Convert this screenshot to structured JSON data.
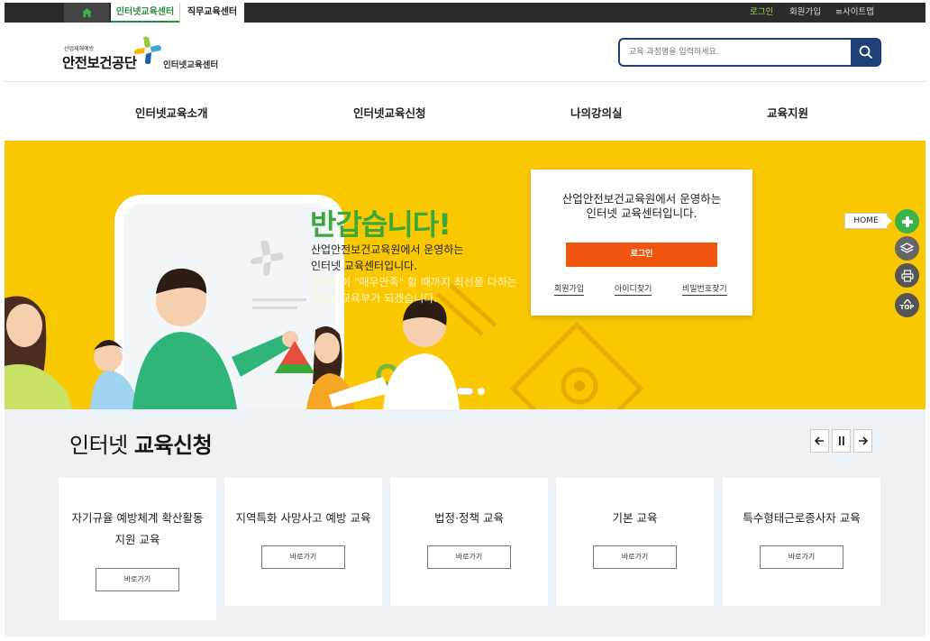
{
  "topbar": {
    "tabs": [
      {
        "label": "인터넷교육센터"
      },
      {
        "label": "직무교육센터"
      }
    ],
    "utility": {
      "login": "로그인",
      "join": "회원가입",
      "sitemap": "≡사이트맵"
    }
  },
  "header": {
    "logo": {
      "small": "산업재해예방",
      "main": "안전보건공단",
      "sub": "인터넷교육센터"
    },
    "search": {
      "placeholder": "교육 과정명을 입력하세요."
    }
  },
  "gnb": {
    "items": [
      {
        "label": "인터넷교육소개"
      },
      {
        "label": "인터넷교육신청"
      },
      {
        "label": "나의강의실"
      },
      {
        "label": "교육지원"
      }
    ]
  },
  "hero": {
    "greeting": "반갑습니다!",
    "lines": [
      "산업안전보건교육원에서 운영하는",
      "인터넷 교육센터입니다.",
      "고객님이 \"매우만족\" 할 때까지 최선을 다하는",
      "이러닝교육부가 되겠습니다."
    ],
    "login_card": {
      "title_line1": "산업안전보건교육원에서 운영하는",
      "title_line2": "인터넷 교육센터입니다.",
      "login_label": "로그인",
      "links": {
        "join": "회원가입",
        "find_id": "아이디찾기",
        "find_pw": "비밀번호찾기"
      }
    }
  },
  "quick": {
    "home_label": "HOME",
    "top_label": "TOP",
    "icons": [
      "plus-icon",
      "layers-icon",
      "print-icon",
      "arrow-up-icon"
    ]
  },
  "courses": {
    "title_normal": "인터넷",
    "title_bold": "교육신청",
    "items": [
      {
        "name_line1": "자기규율 예방체계 확산활동",
        "name_line2": "지원 교육",
        "button": "바로가기"
      },
      {
        "name_line1": "지역특화 사망사고 예방 교육",
        "button": "바로가기"
      },
      {
        "name_line1": "법정·정책 교육",
        "button": "바로가기"
      },
      {
        "name_line1": "기본 교육",
        "button": "바로가기"
      },
      {
        "name_line1": "특수형태근로종사자 교육",
        "button": "바로가기"
      }
    ]
  },
  "colors": {
    "navy": "#1e3f77",
    "hero_yellow": "#f9c800",
    "greeting_green": "#3aa83a",
    "login_orange": "#f0560f",
    "section_bg": "#edf2f7"
  }
}
